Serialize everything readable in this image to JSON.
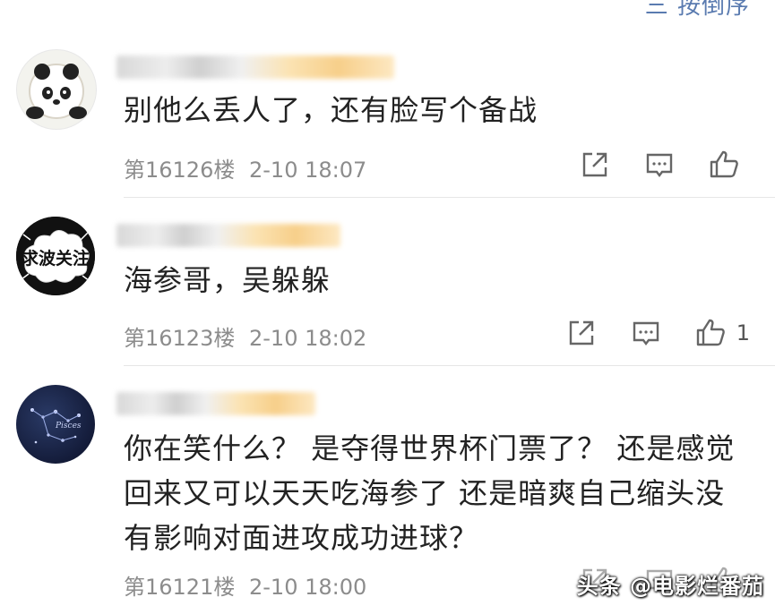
{
  "header": {
    "sort_label": "三 按倒序"
  },
  "comments": [
    {
      "content": "别他么丢人了，还有脸写个备战",
      "floor": "第16126楼",
      "time": "2-10 18:07",
      "likes": ""
    },
    {
      "avatar_text": "求波关注",
      "content": "海参哥，吴躲躲",
      "floor": "第16123楼",
      "time": "2-10 18:02",
      "likes": "1"
    },
    {
      "content": "你在笑什么？ 是夺得世界杯门票了？ 还是感觉回来又可以天天吃海参了 还是暗爽自己缩头没有影响对面进攻成功进球？",
      "floor": "第16121楼",
      "time": "2-10 18:00",
      "likes": ""
    }
  ],
  "icons": {
    "share": "share-icon",
    "reply": "comment-icon",
    "like": "thumbs-up-icon"
  },
  "watermark": "头条 @电影烂番茄",
  "colors": {
    "link": "#5a7bb0",
    "meta": "#8c8c8c",
    "text": "#222222"
  }
}
